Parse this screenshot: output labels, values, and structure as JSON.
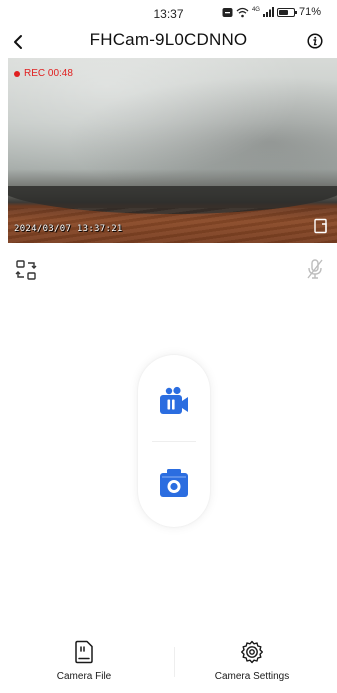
{
  "status_bar": {
    "time": "13:37",
    "signal_label": "4G",
    "battery_text": "71%",
    "battery_level": 0.71,
    "icons": [
      "do-not-disturb-icon",
      "wifi-icon",
      "cell-signal-icon",
      "battery-icon"
    ]
  },
  "header": {
    "title": "FHCam-9L0CDNNO",
    "back_icon": "chevron-left-icon",
    "info_icon": "info-icon"
  },
  "video": {
    "rec_label": "REC 00:48",
    "timestamp": "2024/03/07 13:37:21",
    "fullscreen_icon": "fullscreen-icon"
  },
  "controls": {
    "flip_icon": "flip-camera-icon",
    "mic_icon": "mic-muted-icon"
  },
  "actions": {
    "record_icon": "video-record-pause-icon",
    "snapshot_icon": "camera-snapshot-icon"
  },
  "bottom_nav": {
    "items": [
      {
        "label": "Camera File",
        "icon": "sd-card-icon"
      },
      {
        "label": "Camera Settings",
        "icon": "gear-icon"
      }
    ]
  },
  "colors": {
    "accent": "#2b6de0",
    "record_red": "#e02020"
  }
}
